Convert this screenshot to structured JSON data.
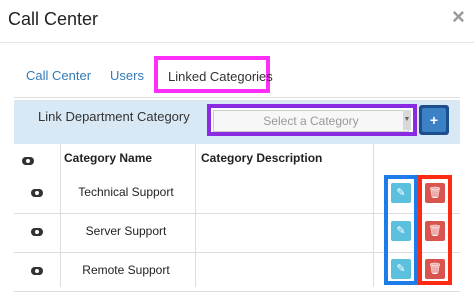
{
  "modal": {
    "title": "Call Center",
    "close_glyph": "×"
  },
  "tabs": [
    {
      "label": "Call Center",
      "active": false
    },
    {
      "label": "Users",
      "active": false
    },
    {
      "label": "Linked Categories",
      "active": true
    }
  ],
  "link_row": {
    "label": "Link Department Category",
    "select_placeholder": "Select a Category",
    "add_button_label": "+"
  },
  "table": {
    "columns": [
      "",
      "Category Name",
      "Category Description",
      ""
    ],
    "rows": [
      {
        "name": "Technical Support",
        "description": ""
      },
      {
        "name": "Server Support",
        "description": ""
      },
      {
        "name": "Remote Support",
        "description": ""
      }
    ]
  },
  "icons": {
    "view": "eye-icon",
    "edit": "edit-icon",
    "delete": "trash-icon"
  },
  "colors": {
    "link_row_bg": "#d9e8f5",
    "tab_highlight": "#ff2ef8",
    "select_highlight": "#8a2be2",
    "edit_highlight": "#1e7ce8",
    "delete_highlight": "#ff2a12",
    "add_button": "#1d4f8c",
    "edit_button": "#5bc0de",
    "delete_button": "#d9534f"
  }
}
